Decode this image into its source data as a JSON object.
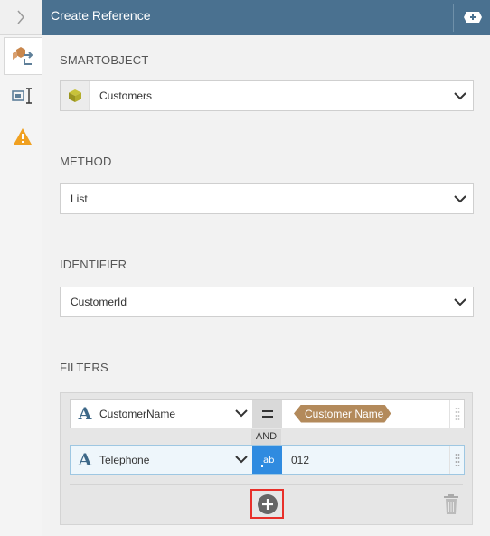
{
  "header": {
    "title": "Create Reference",
    "action_icon": "add-reference-icon"
  },
  "rail": {
    "items": [
      {
        "icon": "chevron-right-icon"
      },
      {
        "icon": "reference-icon",
        "active": true
      },
      {
        "icon": "properties-icon"
      },
      {
        "icon": "warning-icon"
      }
    ]
  },
  "smartobject": {
    "label": "SMARTOBJECT",
    "value": "Customers",
    "icon": "smartobject-cube-icon"
  },
  "method": {
    "label": "METHOD",
    "value": "List"
  },
  "identifier": {
    "label": "IDENTIFIER",
    "value": "CustomerId"
  },
  "filters": {
    "label": "FILTERS",
    "rows": [
      {
        "field": "CustomerName",
        "type_glyph": "A",
        "operator": "=",
        "value_chip": "Customer Name"
      },
      {
        "field": "Telephone",
        "type_glyph": "A",
        "operator_icon": "text-value-icon",
        "value": "012"
      }
    ],
    "conjunction": "AND",
    "add_icon": "add-filter-icon",
    "delete_icon": "trash-icon"
  },
  "colors": {
    "header": "#4a7190",
    "accent": "#2f8be0",
    "chip": "#b38a5b",
    "highlight": "#e8302a",
    "warning": "#f0a020"
  }
}
